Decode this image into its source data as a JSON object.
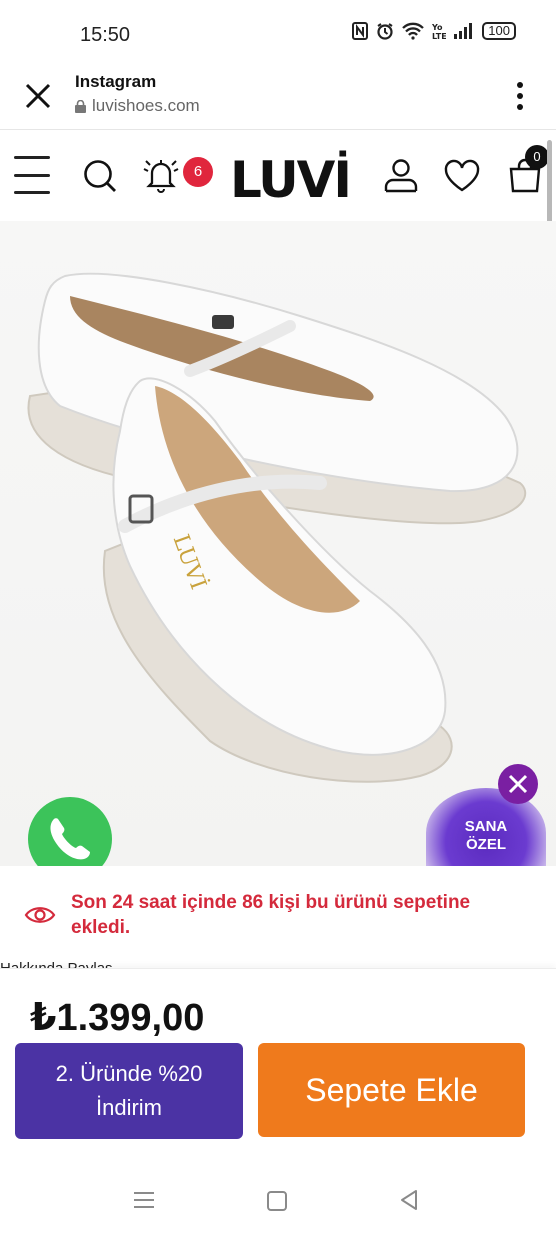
{
  "status_bar": {
    "time": "15:50",
    "battery": "100",
    "icons": [
      "nfc-icon",
      "alarm-icon",
      "wifi-icon",
      "volte-icon",
      "signal-icon",
      "battery-icon"
    ]
  },
  "browser": {
    "title": "Instagram",
    "url": "luvishoes.com",
    "close_icon": "close-icon",
    "menu_icon": "kebab-menu-icon"
  },
  "site_header": {
    "logo": "LUVİ",
    "notification_count": "6",
    "cart_count": "0",
    "icons": [
      "hamburger-icon",
      "search-icon",
      "bell-icon",
      "user-icon",
      "heart-icon",
      "shopping-bag-icon"
    ]
  },
  "product": {
    "image_alt": "white mary jane flat shoes"
  },
  "promo": {
    "label_line1": "SANA",
    "label_line2": "ÖZEL"
  },
  "notice": {
    "text": "Son 24 saat içinde 86 kişi bu ürünü sepetine ekledi."
  },
  "partial_text": "Hakkında Paylaş",
  "purchase": {
    "price": "₺1.399,00",
    "discount_button": "2. Üründe %20 İndirim",
    "add_to_cart": "Sepete Ekle"
  },
  "colors": {
    "discount_button": "#4b33a4",
    "add_to_cart": "#ef7a1c",
    "notice_text": "#d42a3c",
    "badge": "#e0263d",
    "whatsapp": "#3cc35a",
    "promo_purple": "#5b2bbf"
  }
}
